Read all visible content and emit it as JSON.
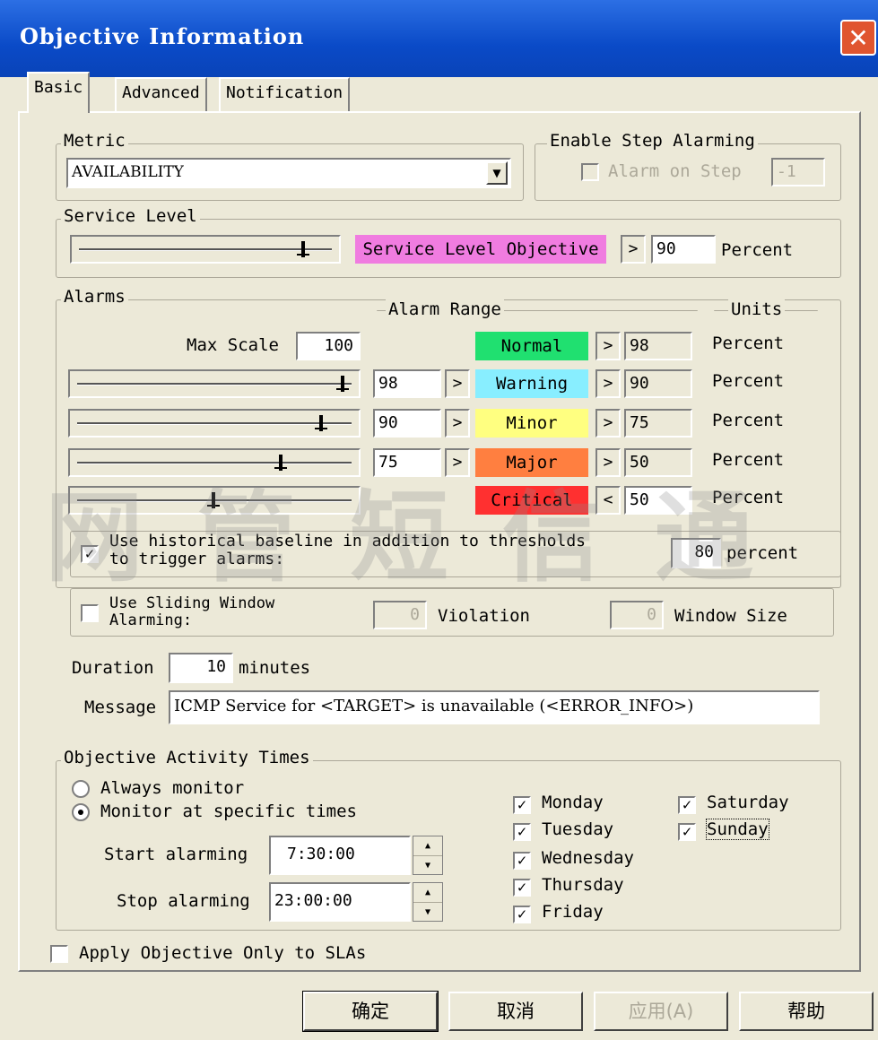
{
  "window": {
    "title": "Objective Information",
    "close": "✕"
  },
  "tabs": [
    "Basic",
    "Advanced",
    "Notification"
  ],
  "metric": {
    "label": "Metric",
    "value": "AVAILABILITY"
  },
  "step_alarming": {
    "label": "Enable Step Alarming",
    "checkbox_label": "Alarm on Step",
    "value": "-1"
  },
  "service_level": {
    "label": "Service Level",
    "objective_label": "Service Level Objective",
    "operator": ">",
    "value": "90",
    "unit": "Percent",
    "slider_level": 0.9,
    "color": "#f07ce0"
  },
  "alarms": {
    "label": "Alarms",
    "range_label": "Alarm Range",
    "units_label": "Units",
    "max_scale_label": "Max Scale",
    "max_scale_value": "100",
    "rows": [
      {
        "name": "Normal",
        "color": "#20e070",
        "low": "",
        "op1": "",
        "op2": ">",
        "high": "98",
        "unit": "Percent",
        "slider_level": null
      },
      {
        "name": "Warning",
        "color": "#88eeff",
        "low": "98",
        "op1": ">",
        "op2": ">",
        "high": "90",
        "unit": "Percent",
        "slider_level": 0.98
      },
      {
        "name": "Minor",
        "color": "#ffff80",
        "low": "90",
        "op1": ">",
        "op2": ">",
        "high": "75",
        "unit": "Percent",
        "slider_level": 0.9
      },
      {
        "name": "Major",
        "color": "#ff7f40",
        "low": "75",
        "op1": ">",
        "op2": ">",
        "high": "50",
        "unit": "Percent",
        "slider_level": 0.75
      },
      {
        "name": "Critical",
        "color": "#ff3030",
        "low": "",
        "op1": "",
        "op2": "<",
        "high": "50",
        "unit": "Percent",
        "slider_level": 0.5
      }
    ]
  },
  "baseline": {
    "checked": true,
    "label_line1": "Use historical baseline in addition to thresholds",
    "label_line2": "to trigger alarms:",
    "value": "80",
    "unit": "percent"
  },
  "sliding": {
    "checked": false,
    "label_line1": "Use Sliding Window",
    "label_line2": "Alarming:",
    "violation_value": "0",
    "violation_label": "Violation",
    "window_value": "0",
    "window_label": "Window Size"
  },
  "duration": {
    "label": "Duration",
    "value": "10",
    "unit": "minutes"
  },
  "message": {
    "label": "Message",
    "value": "ICMP Service for <TARGET> is unavailable (<ERROR_INFO>)"
  },
  "activity": {
    "label": "Objective Activity Times",
    "always": "Always monitor",
    "specific": "Monitor at specific times",
    "selected": "specific",
    "start_label": "Start alarming",
    "start_value": "7:30:00",
    "stop_label": "Stop alarming",
    "stop_value": "23:00:00",
    "days": [
      "Monday",
      "Tuesday",
      "Wednesday",
      "Thursday",
      "Friday",
      "Saturday",
      "Sunday"
    ]
  },
  "apply_sla": {
    "checked": false,
    "label": "Apply Objective Only to SLAs"
  },
  "buttons": {
    "ok": "确定",
    "cancel": "取消",
    "apply": "应用(A)",
    "help": "帮助"
  },
  "watermark": "网管短信通"
}
